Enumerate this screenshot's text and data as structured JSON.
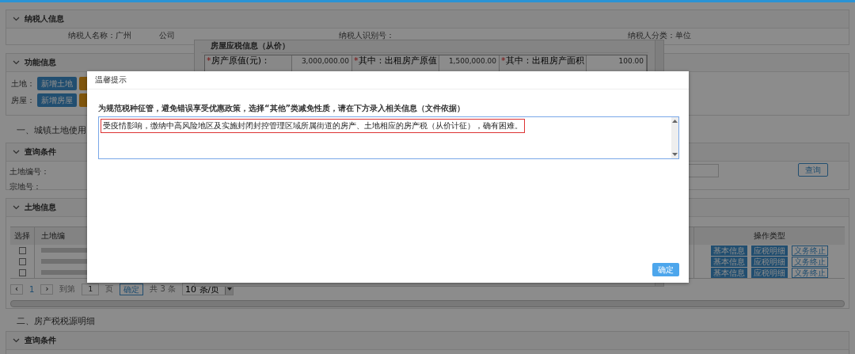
{
  "taxpayer_panel": {
    "title": "纳税人信息",
    "name_label": "纳税人名称：广州",
    "name_suffix": "公司",
    "id_label": "纳税人识别号：",
    "type_label": "纳税人分类：单位"
  },
  "function_panel": {
    "title": "功能信息",
    "rows": [
      {
        "label": "土地：",
        "button": "新增土地"
      },
      {
        "label": "房屋：",
        "button": "新增房屋"
      }
    ]
  },
  "section_1": {
    "title": "一、城镇土地使用"
  },
  "query_panel": {
    "title": "查询条件",
    "fields": [
      "土地编号：",
      "宗地号："
    ],
    "button": "查询"
  },
  "land_panel": {
    "title": "土地信息",
    "columns": [
      "选择",
      "土地编",
      "操作类型"
    ],
    "rows": [
      {
        "checked": false,
        "actions": [
          "基本信息",
          "应税明细",
          "义务终止"
        ]
      },
      {
        "checked": false,
        "actions": [
          "基本信息",
          "应税明细",
          "义务终止"
        ]
      },
      {
        "checked": false,
        "actions": [
          "基本信息",
          "应税明细",
          "义务终止"
        ]
      }
    ],
    "pagination": {
      "prev": "‹",
      "page": "1",
      "next": "›",
      "goto_label": "到第",
      "goto_value": "1",
      "page_unit": "页",
      "confirm": "确定",
      "total": "共 3 条",
      "page_size": "10 条/页"
    }
  },
  "section_2": {
    "title": "二、房产税税源明细",
    "sub_panel": "查询条件"
  },
  "house_dialog": {
    "title": "房屋应税信息（从价）",
    "cells": [
      {
        "required_mark": "*",
        "label": "房产原值(元)：",
        "value": "3,000,000.00"
      },
      {
        "required_mark": "*",
        "label": "其中：出租房产原值",
        "value": "1,500,000.00"
      },
      {
        "required_mark": "*",
        "label": "其中：出租房产面积",
        "value": "100.00"
      }
    ]
  },
  "modal": {
    "title": "温馨提示",
    "instruction": "为规范税种征管，避免错误享受优惠政策，选择“其他”类减免性质，请在下方录入相关信息（文件依据）",
    "text_value": "受疫情影响，缴纳中高风险地区及实施封闭封控管理区域所属街道的房产、土地相应的房产税（从价计征），确有困难。",
    "confirm": "确定"
  }
}
